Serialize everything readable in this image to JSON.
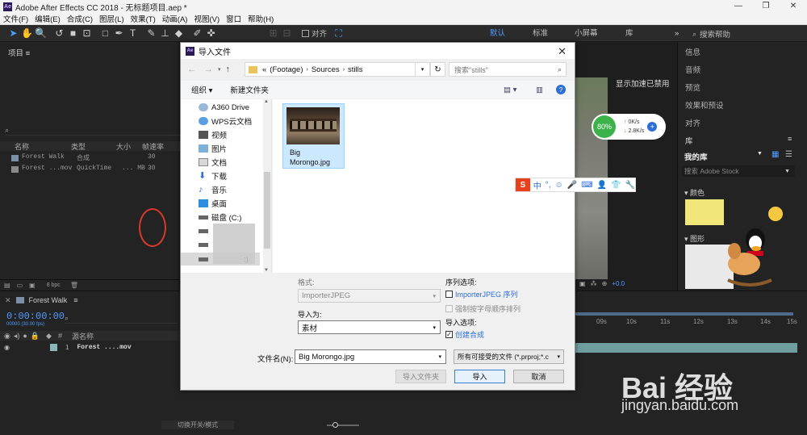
{
  "app": {
    "title": "Adobe After Effects CC 2018 - 无标题项目.aep *",
    "window_controls": [
      "—",
      "❐",
      "✕"
    ]
  },
  "menu": [
    "文件(F)",
    "编辑(E)",
    "合成(C)",
    "图层(L)",
    "效果(T)",
    "动画(A)",
    "视图(V)",
    "窗口",
    "帮助(H)"
  ],
  "toolbar": {
    "align_label": "对齐",
    "workspaces": [
      "默认",
      "标准",
      "小屏幕",
      "库"
    ],
    "search_placeholder": "搜索帮助"
  },
  "project_panel": {
    "title": "项目",
    "columns": [
      "名称",
      "类型",
      "大小",
      "帧速率"
    ],
    "rows": [
      {
        "name": "Forest Walk",
        "type": "合成",
        "size": "",
        "fps": "30"
      },
      {
        "name": "Forest ...mov",
        "type": "QuickTime",
        "size": "... MB",
        "fps": "30"
      }
    ],
    "bpc": "8 bpc"
  },
  "dialog": {
    "title": "导入文件",
    "breadcrumb": [
      "«",
      "(Footage)",
      "Sources",
      "stills"
    ],
    "search_placeholder": "搜索\"stills\"",
    "organize": "组织 ▾",
    "new_folder": "新建文件夹",
    "sidebar": [
      {
        "label": "A360 Drive",
        "icon": "cloud-icon"
      },
      {
        "label": "WPS云文档",
        "icon": "wps-cloud-icon"
      },
      {
        "label": "视频",
        "icon": "video-folder-icon"
      },
      {
        "label": "图片",
        "icon": "pictures-folder-icon"
      },
      {
        "label": "文档",
        "icon": "documents-folder-icon"
      },
      {
        "label": "下载",
        "icon": "download-icon"
      },
      {
        "label": "音乐",
        "icon": "music-icon"
      },
      {
        "label": "桌面",
        "icon": "desktop-icon"
      },
      {
        "label": "磁盘 (C:)",
        "icon": "drive-icon"
      },
      {
        "label": "",
        "icon": "drive-icon"
      },
      {
        "label": "",
        "icon": "drive-icon"
      },
      {
        "label": ":)",
        "icon": "drive-icon"
      }
    ],
    "file": {
      "name": "Big\nMorongo.jpg"
    },
    "format_label": "格式:",
    "format_value": "ImporterJPEG",
    "import_as_label": "导入为:",
    "import_as_value": "素材",
    "sequence_options_label": "序列选项:",
    "sequence_checkbox": "ImporterJPEG 序列",
    "force_alpha_checkbox": "强制按字母顺序排列",
    "import_options_label": "导入选项:",
    "create_comp_checkbox": "创建合成",
    "filename_label": "文件名(N):",
    "filename_value": "Big Morongo.jpg",
    "filetype_value": "所有可接受的文件 (*.prproj;*.c",
    "import_folder": "导入文件夹",
    "import": "导入",
    "cancel": "取消"
  },
  "viewer": {
    "accel_text": "显示加速已禁用",
    "net_percent": "80%",
    "upload": "0K/s",
    "download": "2.8K/s",
    "offset": "+0.0"
  },
  "right_panels": {
    "items": [
      "信息",
      "音频",
      "预览",
      "效果和预设",
      "对齐",
      "库"
    ],
    "library_name": "我的库",
    "stock_search": "搜索 Adobe Stock",
    "colors_label": "颜色",
    "graphics_label": "图形",
    "swatch_color": "#f0e67a"
  },
  "timeline": {
    "comp_name": "Forest Walk",
    "timecode": "0:00:00:00",
    "timecode_sub": "00000 (30.00 fps)",
    "layer_header": "源名称",
    "layer_number": "1",
    "layer_name": "Forest ....mov",
    "switch_label": "切换开关/模式",
    "ruler": [
      "09s",
      "10s",
      "11s",
      "12s",
      "13s",
      "14s",
      "15s"
    ]
  },
  "ime": {
    "label": "中"
  },
  "watermark": {
    "text": "Bai 经验",
    "url": "jingyan.baidu.com"
  }
}
